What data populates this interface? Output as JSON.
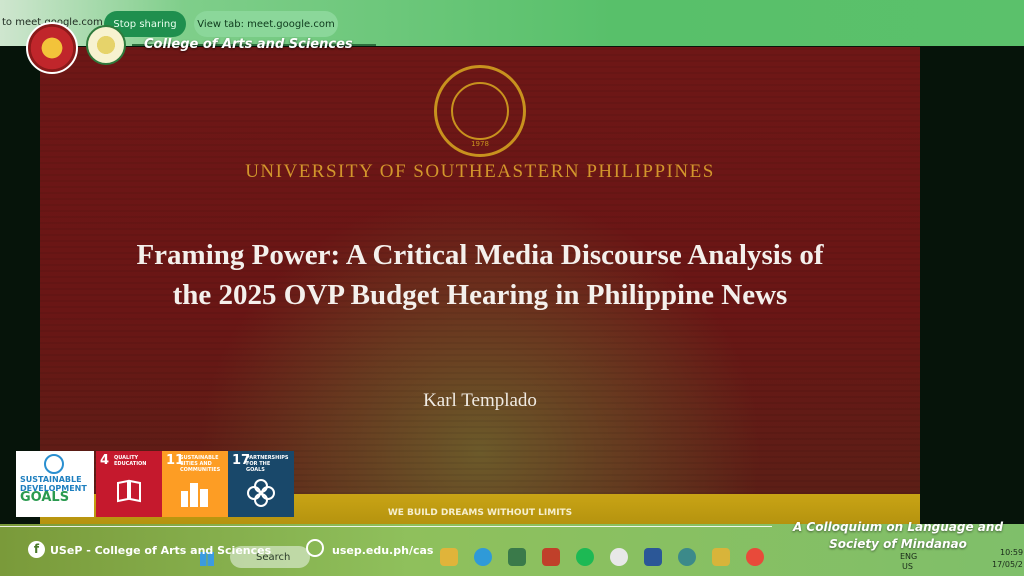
{
  "share_bar": {
    "share_text": "to meet.google.com",
    "stop_label": "Stop sharing",
    "view_tab_label": "View tab: meet.google.com"
  },
  "header": {
    "college": "College of Arts and Sciences"
  },
  "slide": {
    "seal_year": "1978",
    "university": "UNIVERSITY OF SOUTHEASTERN PHILIPPINES",
    "title_line1": "Framing Power: A Critical Media Discourse Analysis of",
    "title_line2": "the 2025 OVP Budget Hearing in Philippine News",
    "presenter": "Karl Templado",
    "slogan": "WE BUILD DREAMS WITHOUT LIMITS"
  },
  "sdg": {
    "main_line1": "SUSTAINABLE",
    "main_line2": "DEVELOPMENT",
    "main_line3": "GOALS",
    "goals": [
      {
        "number": "4",
        "label": "QUALITY EDUCATION",
        "color": "#c5192d"
      },
      {
        "number": "11",
        "label": "SUSTAINABLE CITIES AND COMMUNITIES",
        "color": "#fd9d24"
      },
      {
        "number": "17",
        "label": "PARTNERSHIPS FOR THE GOALS",
        "color": "#19486a"
      }
    ]
  },
  "footer": {
    "facebook_text": "USeP - College of Arts and Sciences",
    "website_text": "usep.edu.ph/cas",
    "colloquium_line1": "A Colloquium on Language and",
    "colloquium_line2": "Society of Mindanao"
  },
  "taskbar": {
    "search_placeholder": "Search",
    "lang_top": "ENG",
    "lang_bottom": "US",
    "time": "10:59",
    "date": "17/05/2"
  },
  "colors": {
    "slide_maroon": "#6e1716",
    "slide_gold": "#d3962c",
    "brand_green": "#58c06a",
    "stop_button": "#1f8f4e"
  }
}
